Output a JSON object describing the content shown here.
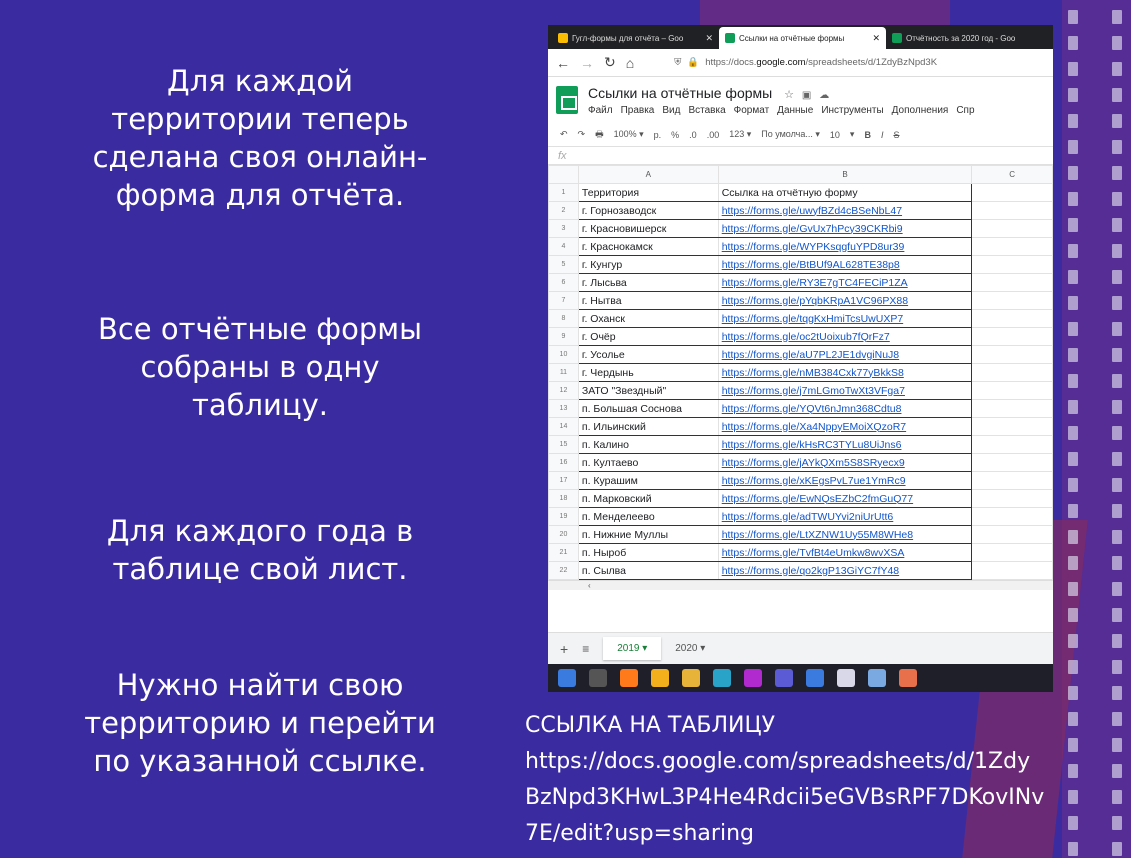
{
  "slide": {
    "paragraphs": [
      [
        "Для каждой",
        "территории теперь",
        "сделана своя онлайн-",
        "форма для отчёта."
      ],
      [
        "Все отчётные формы",
        "собраны в одну",
        "таблицу."
      ],
      [
        "Для каждого года в",
        "таблице свой лист."
      ],
      [
        "Нужно найти свою",
        "территорию и перейти",
        "по указанной ссылке."
      ]
    ],
    "link_heading": "ССЫЛКА НА ТАБЛИЦУ",
    "link_lines": [
      "https://docs.google.com/spreadsheets/d/1Zdy",
      "BzNpd3KHwL3P4He4Rdcii5eGVBsRPF7DKovINv",
      "7E/edit?usp=sharing"
    ]
  },
  "browser": {
    "tabs": [
      {
        "label": "Гугл-формы для отчёта – Goo",
        "color": "#fbbc04"
      },
      {
        "label": "Ссылки на отчётные формы",
        "color": "#0f9d58"
      },
      {
        "label": "Отчётность за 2020 год - Goo",
        "color": "#0f9d58"
      }
    ],
    "url_host": "https://docs.",
    "url_bold": "google.com",
    "url_rest": "/spreadsheets/d/1ZdyBzNpd3K",
    "doc_title": "Ссылки на отчётные формы",
    "menus": [
      "Файл",
      "Правка",
      "Вид",
      "Вставка",
      "Формат",
      "Данные",
      "Инструменты",
      "Дополнения",
      "Спр"
    ],
    "toolbar": [
      "↶",
      "↷",
      "🖶",
      "100%  ▾",
      "р.",
      "%",
      ".0",
      ".00",
      "123 ▾",
      "По умолча...  ▾",
      "10",
      "▾",
      "B",
      "I",
      "S"
    ],
    "fx": "fx",
    "col_headers": [
      "A",
      "B",
      "C"
    ],
    "rows": [
      [
        "Территория",
        "Ссылка на отчётную форму"
      ],
      [
        "г. Горнозаводск",
        "https://forms.gle/uwyfBZd4cBSeNbL47"
      ],
      [
        "г. Красновишерск",
        "https://forms.gle/GvUx7hPcy39CKRbi9"
      ],
      [
        "г. Краснокамск",
        "https://forms.gle/WYPKsqgfuYPD8ur39"
      ],
      [
        "г. Кунгур",
        "https://forms.gle/BtBUf9AL628TE38p8"
      ],
      [
        "г. Лысьва",
        "https://forms.gle/RY3E7gTC4FECiP1ZA"
      ],
      [
        "г. Нытва",
        "https://forms.gle/pYqbKRpA1VC96PX88"
      ],
      [
        "г. Оханск",
        "https://forms.gle/tqgKxHmiTcsUwUXP7"
      ],
      [
        "г. Очёр",
        "https://forms.gle/oc2tUoixub7fQrFz7"
      ],
      [
        "г. Усолье",
        "https://forms.gle/aU7PL2JE1dvgiNuJ8"
      ],
      [
        "г. Чердынь",
        "https://forms.gle/nMB384Cxk77yBkkS8"
      ],
      [
        "ЗАТО \"Звездный\"",
        "https://forms.gle/j7mLGmoTwXt3VFga7"
      ],
      [
        "п. Большая Соснова",
        "https://forms.gle/YQVt6nJmn368Cdtu8"
      ],
      [
        "п. Ильинский",
        "https://forms.gle/Xa4NppyEMoiXQzoR7"
      ],
      [
        "п. Калино",
        "https://forms.gle/kHsRC3TYLu8UiJns6"
      ],
      [
        "п. Култаево",
        "https://forms.gle/jAYkQXm5S8SRyecx9"
      ],
      [
        "п. Курашим",
        "https://forms.gle/xKEgsPvL7ue1YmRc9"
      ],
      [
        "п. Марковский",
        "https://forms.gle/EwNQsEZbC2fmGuQ77"
      ],
      [
        "п. Менделеево",
        "https://forms.gle/adTWUYvi2niUrUtt6"
      ],
      [
        "п. Нижние Муллы",
        "https://forms.gle/LtXZNW1Uy55M8WHe8"
      ],
      [
        "п. Ныроб",
        "https://forms.gle/TvfBt4eUmkw8wvXSA"
      ],
      [
        "п. Сылва",
        "https://forms.gle/qo2kgP13GiYC7fY48"
      ]
    ],
    "sheet_tabs": [
      "2019 ▾",
      "2020 ▾"
    ],
    "taskbar_colors": [
      "#3a7be0",
      "#555",
      "#ff7a1a",
      "#f3b01c",
      "#e8b339",
      "#2aa3c9",
      "#b02ad0",
      "#5b5bd6",
      "#3b7be0",
      "#d8d8e8",
      "#7aa8e0",
      "#e8704a"
    ]
  }
}
